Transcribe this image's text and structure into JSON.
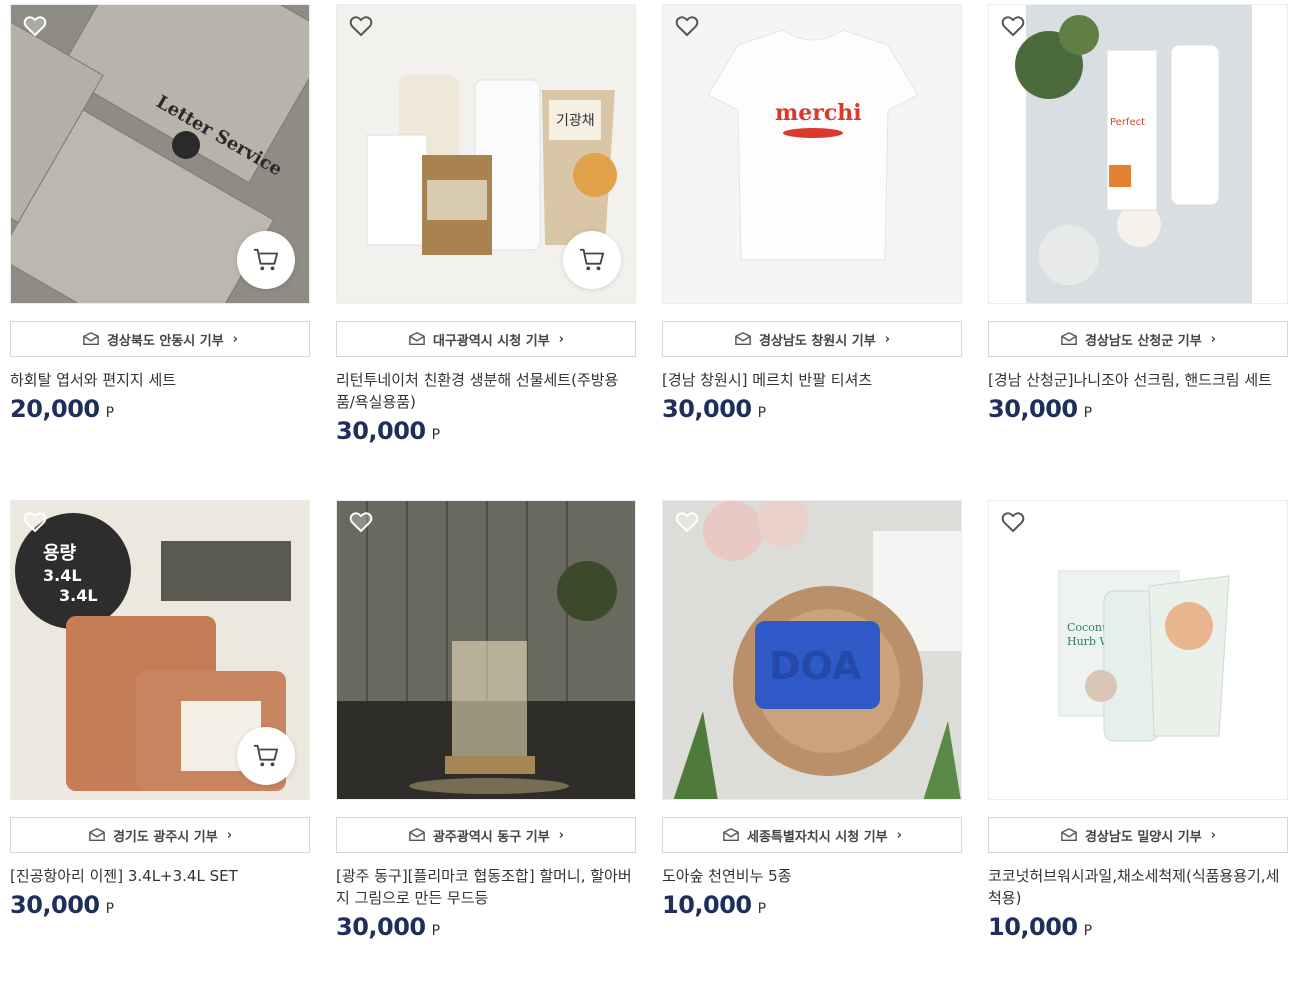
{
  "products": [
    {
      "region": "경상북도 안동시 기부",
      "title": "하회탈 엽서와 편지지 세트",
      "price": "20,000",
      "unit": "P",
      "cart": true,
      "heart_style": "white",
      "image_text": "Letter Service",
      "bg": "#8e8b85"
    },
    {
      "region": "대구광역시 시청 기부",
      "title": "리턴투네이처 친환경 생분해 선물세트(주방용품/욕실용품)",
      "price": "30,000",
      "unit": "P",
      "cart": true,
      "heart_style": "outline",
      "image_text": "기광채",
      "bg": "#f1efec"
    },
    {
      "region": "경상남도 창원시 기부",
      "title": "[경남 창원시] 메르치 반팔 티셔츠",
      "price": "30,000",
      "unit": "P",
      "cart": false,
      "heart_style": "outline",
      "image_text": "merchi",
      "bg": "#f5f5f5"
    },
    {
      "region": "경상남도 산청군 기부",
      "title": "[경남 산청군]나니조아 선크림, 핸드크림 세트",
      "price": "30,000",
      "unit": "P",
      "cart": false,
      "heart_style": "outline",
      "image_text": "Perfect",
      "bg": "#d8dde2"
    },
    {
      "region": "경기도 광주시 기부",
      "title": "[진공항아리 이젠] 3.4L+3.4L SET",
      "price": "30,000",
      "unit": "P",
      "cart": true,
      "heart_style": "white",
      "image_text": "용량 3.4L 3.4L",
      "bg": "#e9e4d8"
    },
    {
      "region": "광주광역시 동구 기부",
      "title": "[광주 동구][플리마코 협동조합] 할머니, 할아버지 그림으로 만든 무드등",
      "price": "30,000",
      "unit": "P",
      "cart": false,
      "heart_style": "white",
      "image_text": "",
      "bg": "#3b3a36"
    },
    {
      "region": "세종특별자치시 시청 기부",
      "title": "도아숲 천연비누 5종",
      "price": "10,000",
      "unit": "P",
      "cart": false,
      "heart_style": "white",
      "image_text": "DOA",
      "bg": "#d9d9d6"
    },
    {
      "region": "경상남도 밀양시 기부",
      "title": "코코넛허브워시과일,채소세척제(식품용용기,세척용)",
      "price": "10,000",
      "unit": "P",
      "cart": false,
      "heart_style": "outline",
      "image_text": "Coconut Hurb Wash",
      "bg": "#ffffff"
    }
  ]
}
